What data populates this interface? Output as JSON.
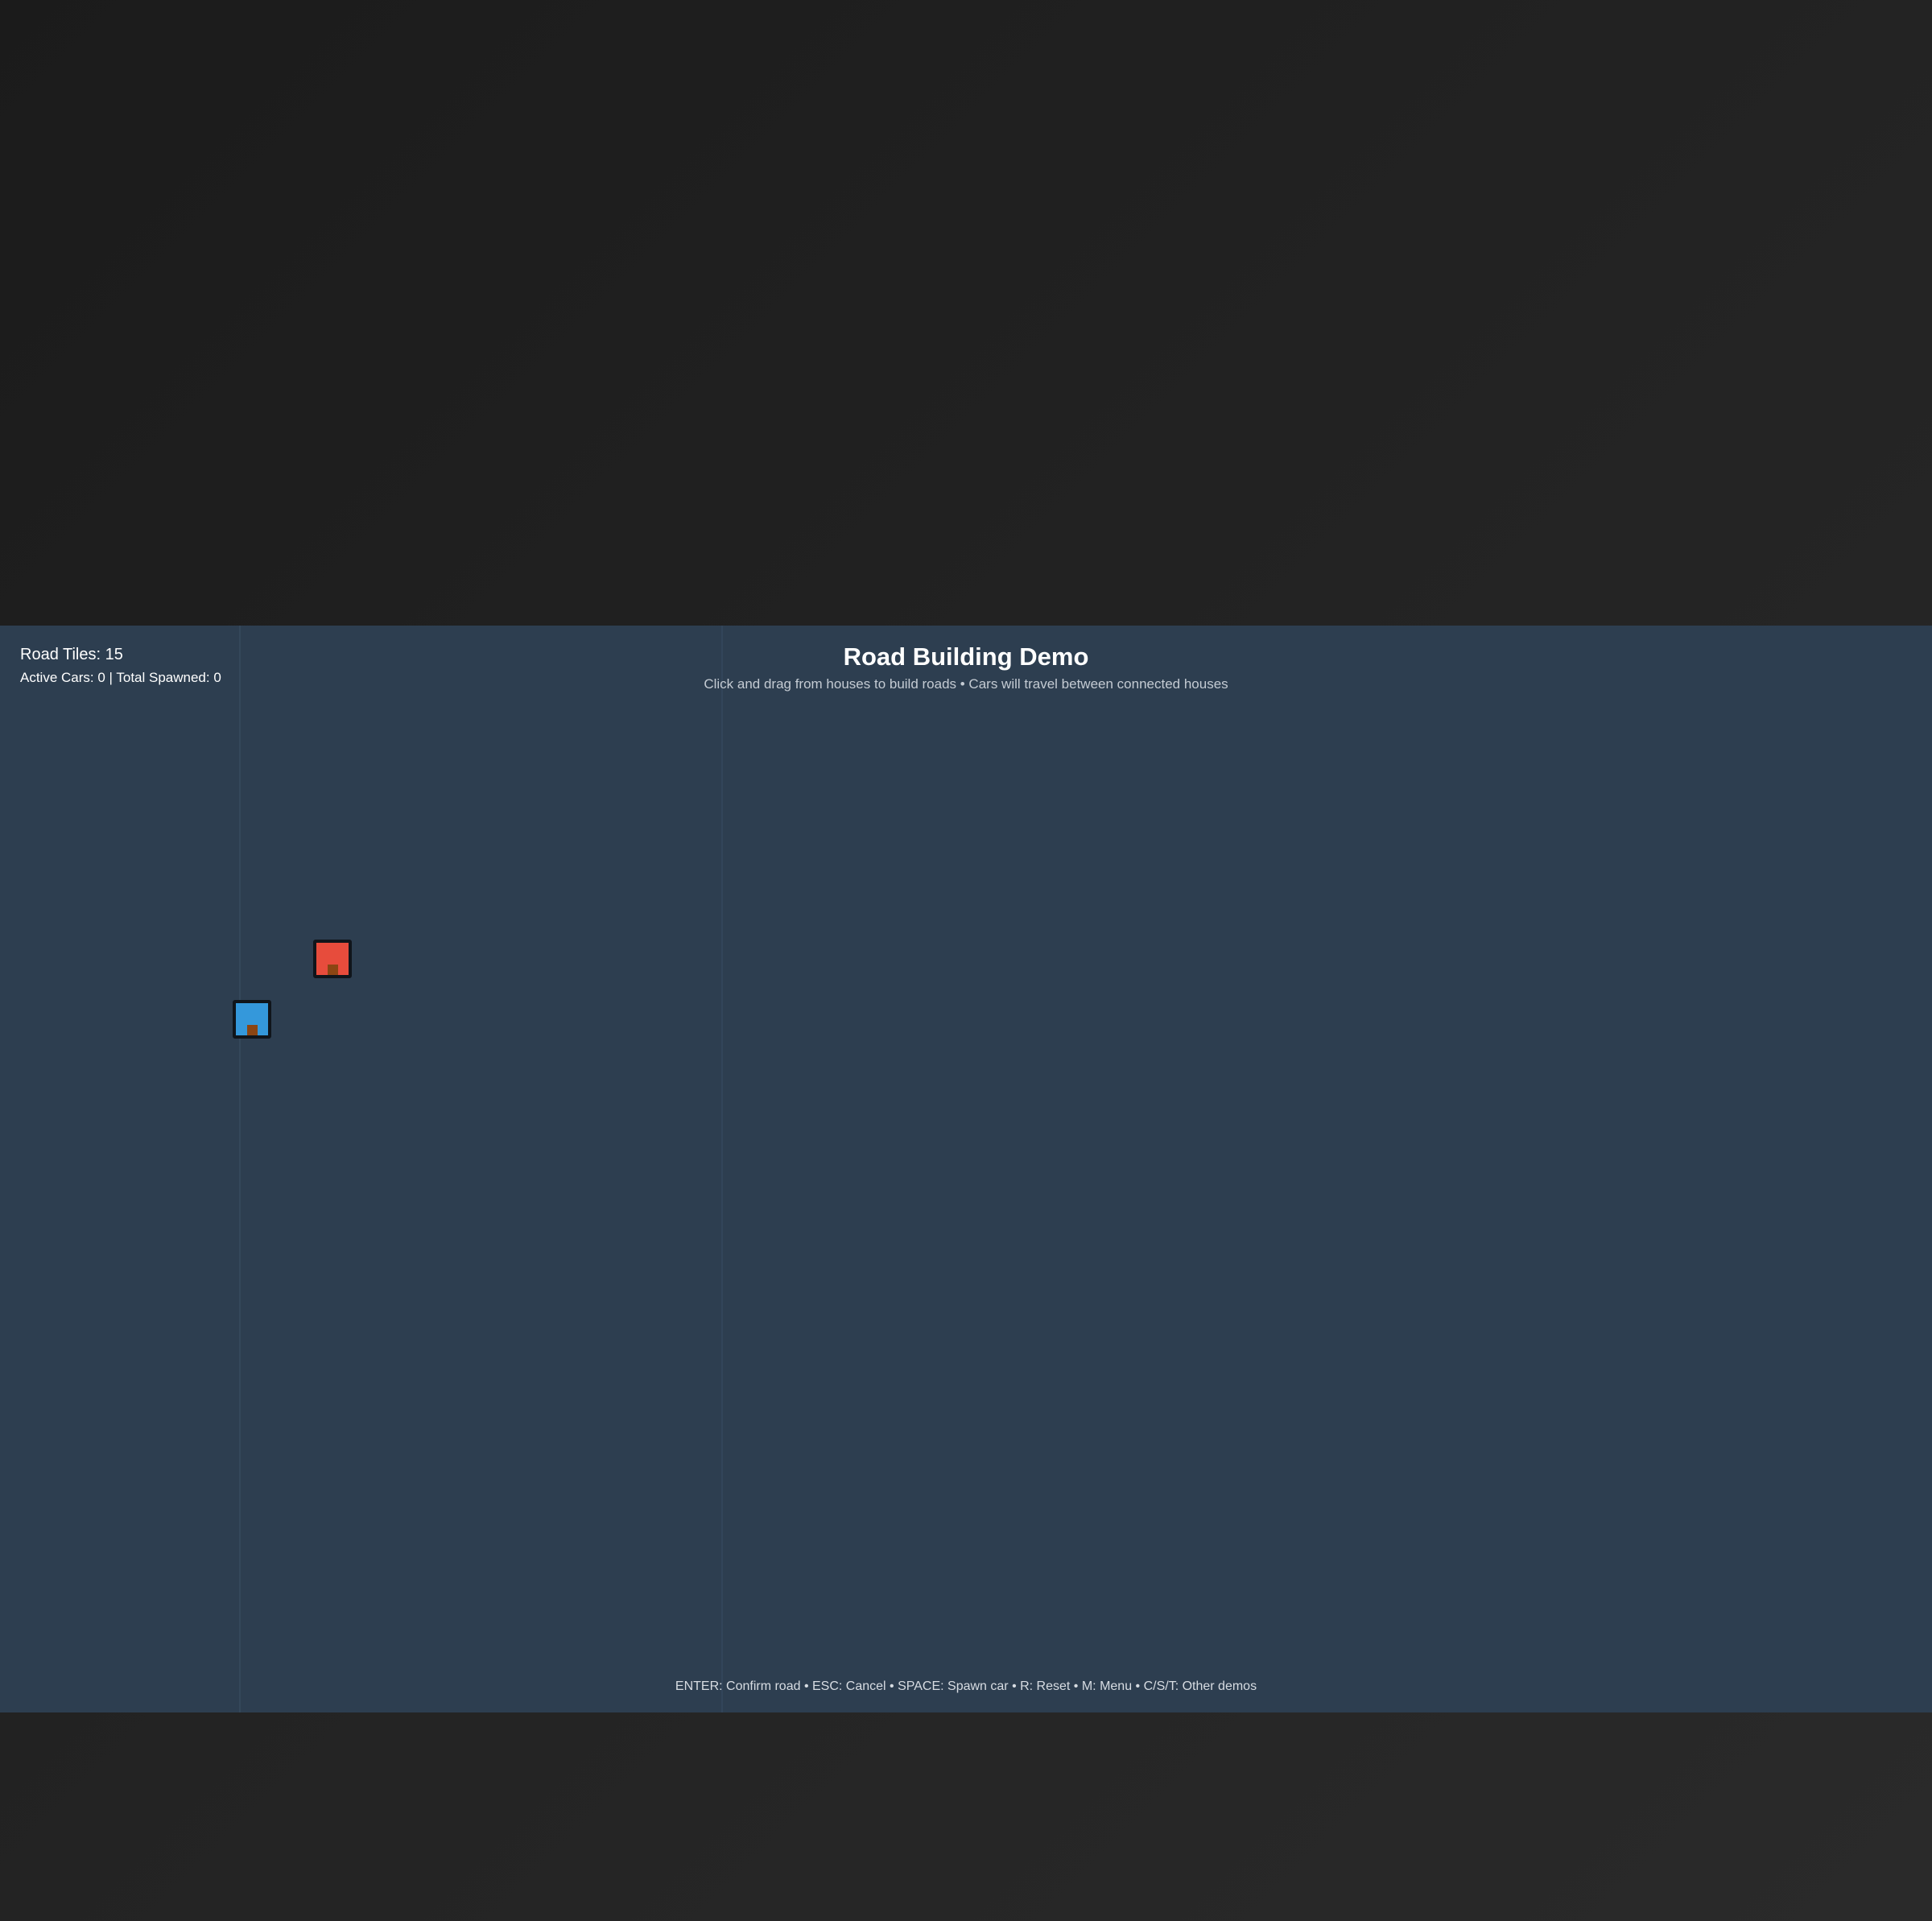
{
  "hud": {
    "road_tiles_label": "Road Tiles: 15",
    "car_stats_label": "Active Cars: 0 | Total Spawned: 0"
  },
  "header": {
    "title": "Road Building Demo",
    "subtitle": "Click and drag from houses to build roads • Cars will travel between connected houses"
  },
  "footer": {
    "controls": "ENTER: Confirm road • ESC: Cancel • SPACE: Spawn car • R: Reset • M: Menu • C/S/T: Other demos"
  },
  "colors": {
    "canvas_bg": "#2d3e50",
    "house_red": "#e74c3c",
    "house_blue": "#3498db",
    "door": "#8b4513"
  },
  "houses": [
    {
      "name": "house-red",
      "color": "#e74c3c"
    },
    {
      "name": "house-blue",
      "color": "#3498db"
    }
  ]
}
